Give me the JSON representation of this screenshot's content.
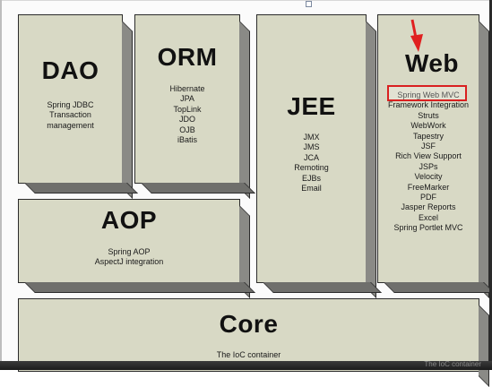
{
  "diagram": {
    "modules": {
      "dao": {
        "title": "DAO",
        "items": [
          "Spring JDBC",
          "Transaction",
          "management"
        ]
      },
      "orm": {
        "title": "ORM",
        "items": [
          "Hibernate",
          "JPA",
          "TopLink",
          "JDO",
          "OJB",
          "iBatis"
        ]
      },
      "jee": {
        "title": "JEE",
        "items": [
          "JMX",
          "JMS",
          "JCA",
          "Remoting",
          "EJBs",
          "Email"
        ]
      },
      "web": {
        "title": "Web",
        "items": [
          "Spring Web MVC",
          "Framework Integration",
          "Struts",
          "WebWork",
          "Tapestry",
          "JSF",
          "Rich View Support",
          "JSPs",
          "Velocity",
          "FreeMarker",
          "PDF",
          "Jasper Reports",
          "Excel",
          "Spring Portlet MVC"
        ]
      },
      "aop": {
        "title": "AOP",
        "items": [
          "Spring AOP",
          "AspectJ integration"
        ]
      },
      "core": {
        "title": "Core",
        "items": [
          "The IoC container"
        ]
      }
    },
    "highlighted_item": "Spring Web MVC",
    "colors": {
      "box_fill": "#d8d9c5",
      "box_side": "#8a8a86",
      "highlight": "#d92020",
      "arrow": "#e02020"
    }
  },
  "footer": {
    "ghost_text": "The IoC container"
  }
}
